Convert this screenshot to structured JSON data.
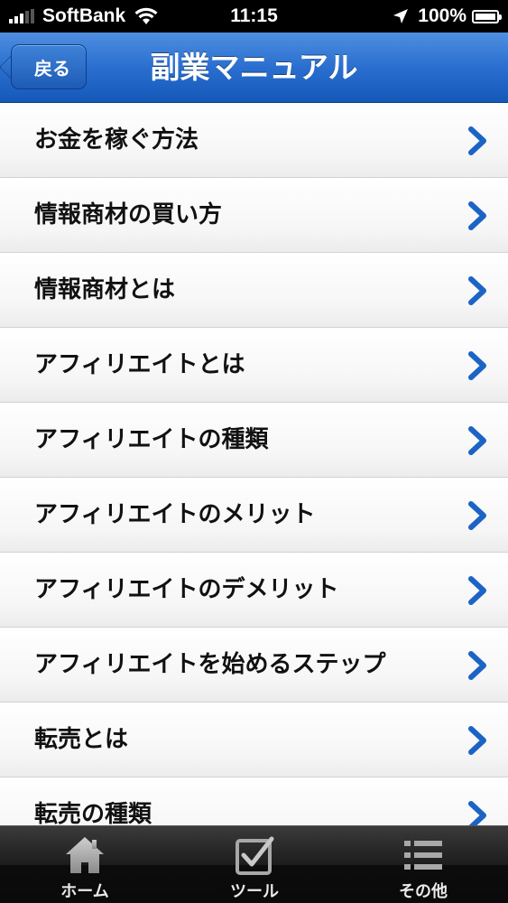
{
  "status_bar": {
    "carrier": "SoftBank",
    "time": "11:15",
    "battery": "100%",
    "battery_level": 1.0
  },
  "nav": {
    "back_label": "戻る",
    "title": "副業マニュアル"
  },
  "list": {
    "items": [
      {
        "label": "お金を稼ぐ方法"
      },
      {
        "label": "情報商材の買い方"
      },
      {
        "label": "情報商材とは"
      },
      {
        "label": "アフィリエイトとは"
      },
      {
        "label": "アフィリエイトの種類"
      },
      {
        "label": "アフィリエイトのメリット"
      },
      {
        "label": "アフィリエイトのデメリット"
      },
      {
        "label": "アフィリエイトを始めるステップ"
      },
      {
        "label": "転売とは"
      },
      {
        "label": "転売の種類"
      }
    ],
    "chevron_icon": "chevron-right-icon",
    "chevron_color": "#1c63c6"
  },
  "tab_bar": {
    "tabs": [
      {
        "label": "ホーム",
        "icon": "home-icon"
      },
      {
        "label": "ツール",
        "icon": "checkbox-icon"
      },
      {
        "label": "その他",
        "icon": "list-icon"
      }
    ]
  },
  "colors": {
    "nav_blue": "#2a6fd0",
    "tab_bar": "#1d1d1d"
  }
}
